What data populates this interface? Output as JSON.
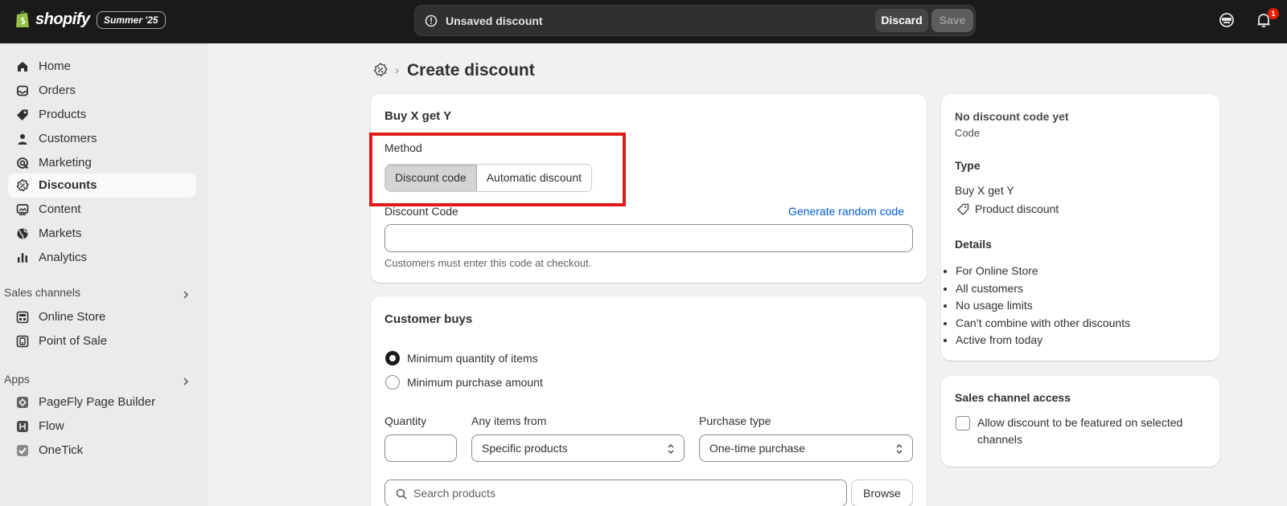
{
  "topbar": {
    "brand": "shopify",
    "edition": "Summer '25",
    "unsaved_text": "Unsaved discount",
    "discard_label": "Discard",
    "save_label": "Save",
    "notification_count": "1"
  },
  "sidebar": {
    "items": [
      {
        "label": "Home",
        "icon": "home-icon"
      },
      {
        "label": "Orders",
        "icon": "inbox-icon"
      },
      {
        "label": "Products",
        "icon": "tag-icon"
      },
      {
        "label": "Customers",
        "icon": "person-icon"
      },
      {
        "label": "Marketing",
        "icon": "target-icon"
      },
      {
        "label": "Discounts",
        "icon": "discount-icon",
        "active": true
      },
      {
        "label": "Content",
        "icon": "image-icon"
      },
      {
        "label": "Markets",
        "icon": "globe-icon"
      },
      {
        "label": "Analytics",
        "icon": "bar-chart-icon"
      }
    ],
    "sales_channels_title": "Sales channels",
    "sales_channels": [
      {
        "label": "Online Store",
        "icon": "store-icon"
      },
      {
        "label": "Point of Sale",
        "icon": "pos-icon"
      }
    ],
    "apps_title": "Apps",
    "apps": [
      {
        "label": "PageFly Page Builder",
        "icon": "pagefly-icon"
      },
      {
        "label": "Flow",
        "icon": "flow-icon"
      },
      {
        "label": "OneTick",
        "icon": "onetick-icon"
      }
    ]
  },
  "page": {
    "title": "Create discount",
    "separator": "›"
  },
  "method_card": {
    "title": "Buy X get Y",
    "method_label": "Method",
    "method_options": [
      "Discount code",
      "Automatic discount"
    ],
    "selected_method": "Discount code",
    "code_label": "Discount Code",
    "generate_link": "Generate random code",
    "code_value": "",
    "code_hint": "Customers must enter this code at checkout."
  },
  "buys_card": {
    "title": "Customer buys",
    "radio_options": [
      "Minimum quantity of items",
      "Minimum purchase amount"
    ],
    "selected_radio": "Minimum quantity of items",
    "quantity_label": "Quantity",
    "quantity_value": "",
    "items_from_label": "Any items from",
    "items_from_value": "Specific products",
    "purchase_type_label": "Purchase type",
    "purchase_type_value": "One-time purchase",
    "search_placeholder": "Search products",
    "browse_label": "Browse"
  },
  "summary_card": {
    "code_title": "No discount code yet",
    "code_subtitle": "Code",
    "type_heading": "Type",
    "type_value": "Buy X get Y",
    "type_tag": "Product discount",
    "details_heading": "Details",
    "details": [
      "For Online Store",
      "All customers",
      "No usage limits",
      "Can’t combine with other discounts",
      "Active from today"
    ]
  },
  "channel_card": {
    "title": "Sales channel access",
    "checkbox_label_line1": "Allow discount to be featured on selected",
    "checkbox_label_line2": "channels",
    "checked": false
  },
  "colors": {
    "topbar": "#1a1a1a",
    "highlight": "#e01b1b",
    "link": "#005bd3",
    "badge": "#e51c00"
  }
}
